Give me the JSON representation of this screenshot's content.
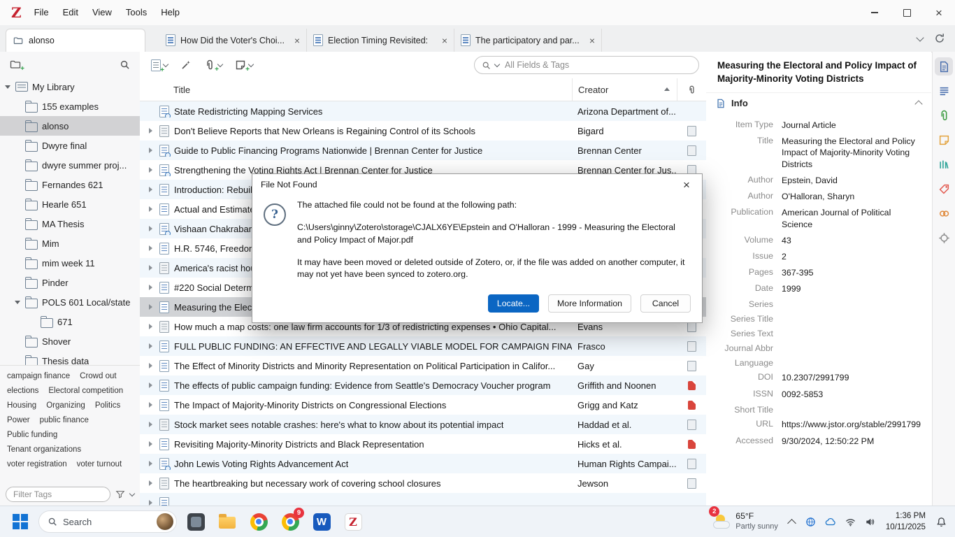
{
  "titlebar": {
    "menus": [
      "File",
      "Edit",
      "View",
      "Tools",
      "Help"
    ]
  },
  "tabbar": {
    "library_tab": "alonso",
    "doc_tabs": [
      {
        "label": "How Did the Voter's Choi..."
      },
      {
        "label": "Election Timing Revisited:"
      },
      {
        "label": "The participatory and par..."
      }
    ]
  },
  "collections": {
    "items": [
      {
        "label": "My Library",
        "icon": "library",
        "depth": 0,
        "chevron": "expanded"
      },
      {
        "label": "155 examples",
        "icon": "folder",
        "depth": 1
      },
      {
        "label": "alonso",
        "icon": "folder",
        "depth": 1,
        "selected": true
      },
      {
        "label": "Dwyre final",
        "icon": "folder",
        "depth": 1
      },
      {
        "label": "dwyre summer proj...",
        "icon": "folder",
        "depth": 1
      },
      {
        "label": "Fernandes 621",
        "icon": "folder",
        "depth": 1
      },
      {
        "label": "Hearle 651",
        "icon": "folder",
        "depth": 1
      },
      {
        "label": "MA Thesis",
        "icon": "folder",
        "depth": 1
      },
      {
        "label": "Mim",
        "icon": "folder",
        "depth": 1
      },
      {
        "label": "mim week 11",
        "icon": "folder",
        "depth": 1
      },
      {
        "label": "Pinder",
        "icon": "folder",
        "depth": 1
      },
      {
        "label": "POLS 601 Local/state",
        "icon": "folder",
        "depth": 1,
        "chevron": "expanded"
      },
      {
        "label": "671",
        "icon": "folder",
        "depth": 2
      },
      {
        "label": "Shover",
        "icon": "folder",
        "depth": 1
      },
      {
        "label": "Thesis data",
        "icon": "folder",
        "depth": 1
      }
    ],
    "tags": [
      "campaign finance",
      "Crowd out",
      "elections",
      "Electoral competition",
      "Housing",
      "Organizing",
      "Politics",
      "Power",
      "public finance",
      "Public funding",
      "Tenant organizations",
      "voter registration",
      "voter turnout"
    ],
    "filter_placeholder": "Filter Tags"
  },
  "toolbar": {
    "search_placeholder": "All Fields & Tags"
  },
  "table": {
    "columns": {
      "title": "Title",
      "creator": "Creator"
    },
    "rows": [
      {
        "title": "State Redistricting Mapping Services",
        "creator": "Arizona Department of...",
        "icon": "web",
        "chevron": false,
        "attach": "none"
      },
      {
        "title": "Don't Believe Reports that New Orleans is Regaining Control of its Schools",
        "creator": "Bigard",
        "icon": "news",
        "chevron": true,
        "attach": "gray"
      },
      {
        "title": "Guide to Public Financing Programs Nationwide | Brennan Center for Justice",
        "creator": "Brennan Center",
        "icon": "web",
        "chevron": true,
        "attach": "gray"
      },
      {
        "title": "Strengthening the Voting Rights Act | Brennan Center for Justice",
        "creator": "Brennan Center for Jus...",
        "icon": "web",
        "chevron": true,
        "attach": "gray"
      },
      {
        "title": "Introduction: Rebuil",
        "creator": "",
        "icon": "doc",
        "chevron": true,
        "attach": "none"
      },
      {
        "title": "Actual and Estimate",
        "creator": "",
        "icon": "doc",
        "chevron": true,
        "attach": "none"
      },
      {
        "title": "Vishaan Chakrabarti",
        "creator": "",
        "icon": "web",
        "chevron": true,
        "attach": "none"
      },
      {
        "title": "H.R. 5746, Freedom",
        "creator": "",
        "icon": "doc",
        "chevron": true,
        "attach": "none"
      },
      {
        "title": "America's racist hou",
        "creator": "",
        "icon": "news",
        "chevron": true,
        "attach": "none"
      },
      {
        "title": "#220 Social Determi",
        "creator": "",
        "icon": "doc",
        "chevron": true,
        "attach": "none"
      },
      {
        "title": "Measuring the Elect",
        "creator": "",
        "icon": "doc",
        "chevron": true,
        "attach": "none",
        "selected": true
      },
      {
        "title": "How much a map costs: one law firm accounts for 1/3 of redistricting expenses • Ohio Capital...",
        "creator": "Evans",
        "icon": "news",
        "chevron": true,
        "attach": "gray"
      },
      {
        "title": "FULL PUBLIC FUNDING: AN EFFECTIVE AND LEGALLY VIABLE MODEL FOR CAMPAIGN FINANCE ...",
        "creator": "Frasco",
        "icon": "doc",
        "chevron": true,
        "attach": "gray"
      },
      {
        "title": "The Effect of Minority Districts and Minority Representation on Political Participation in Califor...",
        "creator": "Gay",
        "icon": "doc",
        "chevron": true,
        "attach": "gray"
      },
      {
        "title": "The effects of public campaign funding: Evidence from Seattle's Democracy Voucher program",
        "creator": "Griffith and Noonen",
        "icon": "doc",
        "chevron": true,
        "attach": "red"
      },
      {
        "title": "The Impact of Majority-Minority Districts on Congressional Elections",
        "creator": "Grigg and Katz",
        "icon": "doc",
        "chevron": true,
        "attach": "red"
      },
      {
        "title": "Stock market sees notable crashes: here's what to know about its potential impact",
        "creator": "Haddad et al.",
        "icon": "news",
        "chevron": true,
        "attach": "gray"
      },
      {
        "title": "Revisiting Majority-Minority Districts and Black Representation",
        "creator": "Hicks et al.",
        "icon": "doc",
        "chevron": true,
        "attach": "red"
      },
      {
        "title": "John Lewis Voting Rights Advancement Act",
        "creator": "Human Rights Campai...",
        "icon": "web",
        "chevron": true,
        "attach": "gray"
      },
      {
        "title": "The heartbreaking but necessary work of covering school closures",
        "creator": "Jewson",
        "icon": "news",
        "chevron": true,
        "attach": "gray"
      },
      {
        "title": "",
        "creator": "",
        "icon": "doc",
        "chevron": true,
        "attach": "none"
      }
    ]
  },
  "dialog": {
    "title": "File Not Found",
    "line1": "The attached file could not be found at the following path:",
    "path": "C:\\Users\\ginny\\Zotero\\storage\\CJALX6YE\\Epstein and O'Halloran - 1999 - Measuring the Electoral and Policy Impact of Major.pdf",
    "line2": "It may have been moved or deleted outside of Zotero, or, if the file was added on another computer, it may not yet have been synced to zotero.org.",
    "locate": "Locate...",
    "more_info": "More Information",
    "cancel": "Cancel"
  },
  "item_pane": {
    "title": "Measuring the Electoral and Policy Impact of Majority-Minority Voting Districts",
    "info_label": "Info",
    "fields": [
      {
        "label": "Item Type",
        "value": "Journal Article"
      },
      {
        "label": "Title",
        "value": "Measuring the Electoral and Policy Impact of Majority-Minority Voting Districts"
      },
      {
        "label": "Author",
        "value": "Epstein, David"
      },
      {
        "label": "Author",
        "value": "O'Halloran, Sharyn"
      },
      {
        "label": "Publication",
        "value": "American Journal of Political Science"
      },
      {
        "label": "Volume",
        "value": "43"
      },
      {
        "label": "Issue",
        "value": "2"
      },
      {
        "label": "Pages",
        "value": "367-395"
      },
      {
        "label": "Date",
        "value": "1999"
      },
      {
        "label": "Series",
        "value": ""
      },
      {
        "label": "Series Title",
        "value": ""
      },
      {
        "label": "Series Text",
        "value": ""
      },
      {
        "label": "Journal Abbr",
        "value": ""
      },
      {
        "label": "Language",
        "value": ""
      },
      {
        "label": "DOI",
        "value": "10.2307/2991799"
      },
      {
        "label": "ISSN",
        "value": "0092-5853"
      },
      {
        "label": "Short Title",
        "value": ""
      },
      {
        "label": "URL",
        "value": "https://www.jstor.org/stable/2991799"
      },
      {
        "label": "Accessed",
        "value": "9/30/2024, 12:50:22 PM"
      }
    ]
  },
  "sidenav": {
    "items": [
      {
        "name": "sidenav-info-icon",
        "symbol": "#sym-doc",
        "color": "#4a6fae",
        "selected": true
      },
      {
        "name": "sidenav-abstract-icon",
        "symbol": "#sym-lines",
        "color": "#4a6fae"
      },
      {
        "name": "sidenav-attachments-icon",
        "symbol": "#sym-clip",
        "color": "#3f9d44"
      },
      {
        "name": "sidenav-notes-icon",
        "symbol": "#sym-note",
        "color": "#e3a23c"
      },
      {
        "name": "sidenav-libraries-icon",
        "symbol": "#sym-stack",
        "color": "#35a79c"
      },
      {
        "name": "sidenav-tags-icon",
        "symbol": "#sym-tag",
        "color": "#e2574d"
      },
      {
        "name": "sidenav-related-icon",
        "symbol": "#sym-links",
        "color": "#e08a3c"
      },
      {
        "name": "sidenav-locate-icon",
        "symbol": "#sym-locate",
        "color": "#8a8a8a"
      }
    ]
  },
  "taskbar": {
    "search_label": "Search",
    "icons": [
      "start",
      "search",
      "app-dark",
      "file-explorer",
      "chrome",
      "chrome-profile",
      "word",
      "zotero"
    ],
    "tray_icons": [
      "hidden-icons-chevron",
      "globe",
      "onedrive-cloud",
      "wifi",
      "volume",
      "notification-bell"
    ],
    "chrome_badge": "9",
    "notif_badge": "2",
    "weather_temp": "65°F",
    "weather_desc": "Partly sunny",
    "time": "1:36 PM",
    "date": "10/11/2025"
  }
}
